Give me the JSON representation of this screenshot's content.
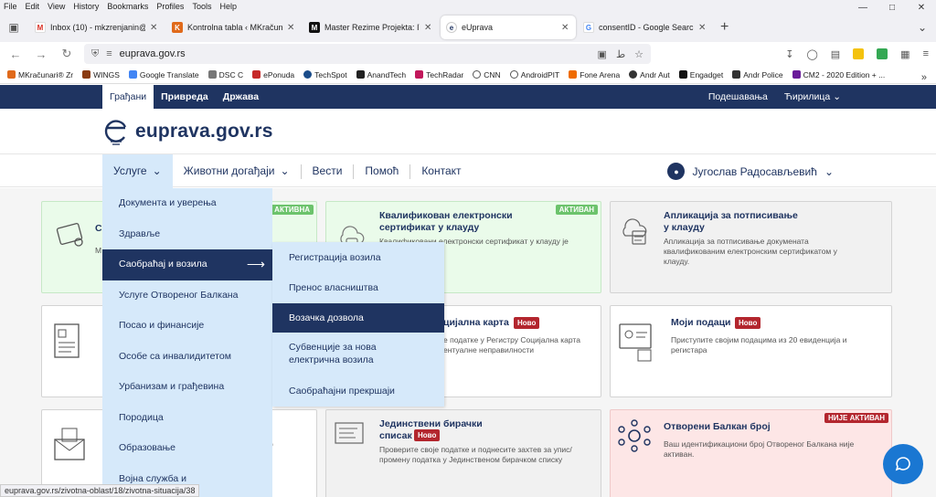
{
  "browser": {
    "menu": [
      "File",
      "Edit",
      "View",
      "History",
      "Bookmarks",
      "Profiles",
      "Tools",
      "Help"
    ],
    "tabs": [
      {
        "title": "Inbox (10) - mkzrenjanin@gmail.",
        "color": "#d93025",
        "glyph": "M"
      },
      {
        "title": "Kontrolna tabla ‹ MKračunari —",
        "color": "#e06a1b",
        "glyph": "K"
      },
      {
        "title": "Master Rezime Projekta: IT Ser |",
        "color": "#111111",
        "glyph": "M"
      },
      {
        "title": "eUprava",
        "color": "#ffffff",
        "glyph": "e"
      },
      {
        "title": "consentID - Google Search",
        "color": "#4285f4",
        "glyph": "G"
      }
    ],
    "url": "euprava.gov.rs",
    "bookmarks": [
      {
        "label": "MKračunari® Zr",
        "color": "#e06a1b"
      },
      {
        "label": "WINGS",
        "color": "#8a3b12"
      },
      {
        "label": "Google Translate",
        "color": "#4285f4"
      },
      {
        "label": "DSC C",
        "color": "#777777"
      },
      {
        "label": "ePonuda",
        "color": "#c62828"
      },
      {
        "label": "TechSpot",
        "color": "#1a4c8a"
      },
      {
        "label": "AnandTech",
        "color": "#222222"
      },
      {
        "label": "TechRadar",
        "color": "#c2185b"
      },
      {
        "label": "CNN",
        "color": "#555555"
      },
      {
        "label": "AndroidPIT",
        "color": "#555555"
      },
      {
        "label": "Fone Arena",
        "color": "#ef6c00"
      },
      {
        "label": "Andr Aut",
        "color": "#333333"
      },
      {
        "label": "Engadget",
        "color": "#111111"
      },
      {
        "label": "Andr Police",
        "color": "#333333"
      },
      {
        "label": "CM2 - 2020 Edition + ...",
        "color": "#6a1b9a"
      }
    ],
    "status_url": "euprava.gov.rs/zivotna-oblast/18/zivotna-situacija/38"
  },
  "site": {
    "top_tabs": [
      "Грађани",
      "Привреда",
      "Држава"
    ],
    "top_right": [
      "Подешавања",
      "Ћирилица"
    ],
    "logo": "euprava.gov.rs",
    "nav": [
      "Услуге",
      "Животни догађаји",
      "Вести",
      "Помоћ",
      "Контакт"
    ],
    "user": "Југослав Радосављевић"
  },
  "dropdown": [
    "Документа и уверења",
    "Здравље",
    "Саобраћај и возила",
    "Услуге Отвореног Балкана",
    "Посао и финансије",
    "Особе са инвалидитетом",
    "Урбанизам и грађевина",
    "Породица",
    "Образовање",
    "Војна служба и"
  ],
  "submenu": [
    "Регистрација возила",
    "Пренос власништва",
    "Возачка дозвола",
    "Субвенције за нова",
    "електрична возила",
    "Саобраћајни прекршаји"
  ],
  "cards": {
    "c1": {
      "title_frag": "Се",
      "desc_frag": "М",
      "badge": "АКТИВНА"
    },
    "c2": {
      "title": "Квалификован електронски",
      "title2": "сертификат у клауду",
      "desc": "Квалификовани електронски сертификат у клауду је",
      "badge": "АКТИВАН"
    },
    "c3": {
      "title": "Апликација за потписивање",
      "title2": "у клауду",
      "desc": "Апликација за потписивање докумената",
      "desc2": "квалификованим електронским сертификатом у",
      "desc3": "клауду."
    },
    "c5": {
      "title_frag": "цијална карта",
      "badge": "Ново",
      "desc": "е податке у Регистру Социјална карта",
      "desc2": "ентуалне неправилности"
    },
    "c6": {
      "title": "Моји подаци",
      "badge": "Ново",
      "desc": "Приступите својим подацима из 20 евиденција и",
      "desc2": "регистара"
    },
    "c7": {
      "desc_frag": "р"
    },
    "c8": {
      "title": "Јединствени бирачки",
      "title2": "списак",
      "badge": "Ново",
      "desc": "Проверите своје податке и поднесите захтев за упис/",
      "desc2": "промену податка у Јединственом бирачком списку"
    },
    "c9": {
      "title": "Отворени Балкан број",
      "badge": "НИЈЕ АКТИВАН",
      "desc": "Ваш идентификациони број Отвореног Балкана није",
      "desc2": "активан."
    }
  },
  "colors": {
    "brand": "#1f3461",
    "menu_bg": "#d6e9fa",
    "active_green": "#6cc36c",
    "badge_red": "#b3262e",
    "chat_blue": "#1a77d2"
  }
}
